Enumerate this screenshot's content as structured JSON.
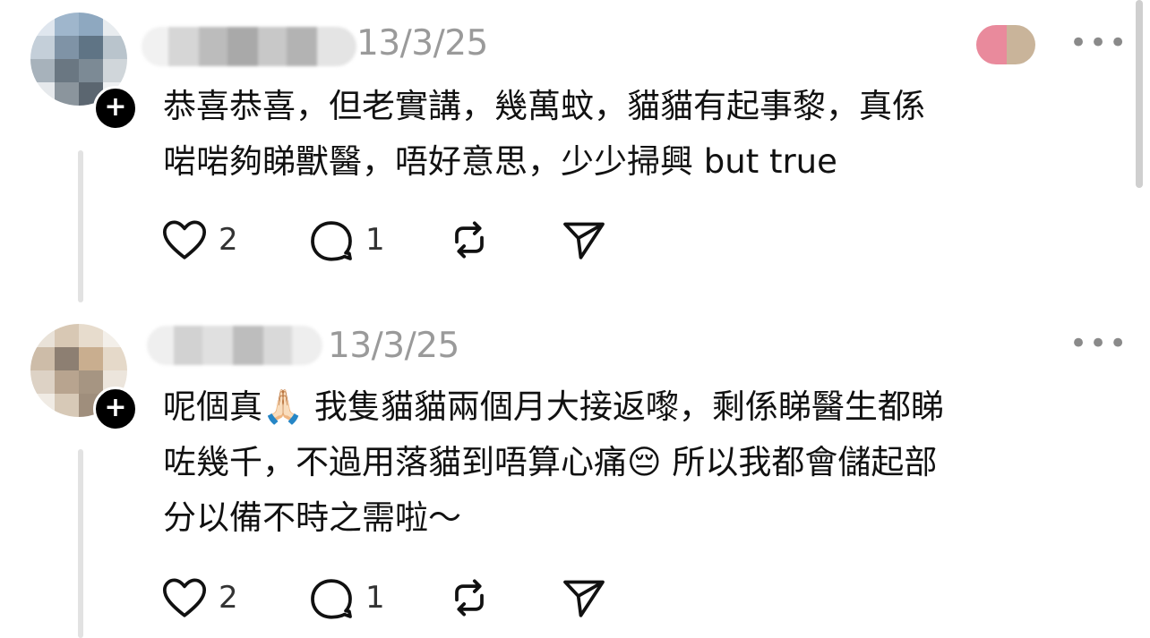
{
  "posts": [
    {
      "date": "13/3/25",
      "more_label": "•••",
      "text": "恭喜恭喜，但老實講，幾萬蚊，貓貓有起事黎，真係\n啱啱夠睇獸醫，唔好意思，少少掃興 but true",
      "likes": "2",
      "replies": "1",
      "add_label": "+"
    },
    {
      "date": "13/3/25",
      "more_label": "•••",
      "text": "呢個真🙏🏻 我隻貓貓兩個月大接返嚟，剩係睇醫生都睇\n咗幾千，不過用落貓到唔算心痛😔 所以我都會儲起部\n分以備不時之需啦～",
      "likes": "2",
      "replies": "1",
      "add_label": "+"
    }
  ],
  "icons": {
    "like": "heart-icon",
    "reply": "comment-icon",
    "repost": "repost-icon",
    "share": "send-icon"
  },
  "colors": {
    "muted_text": "#9a9a9a",
    "thread_line": "#e2e2e2"
  }
}
